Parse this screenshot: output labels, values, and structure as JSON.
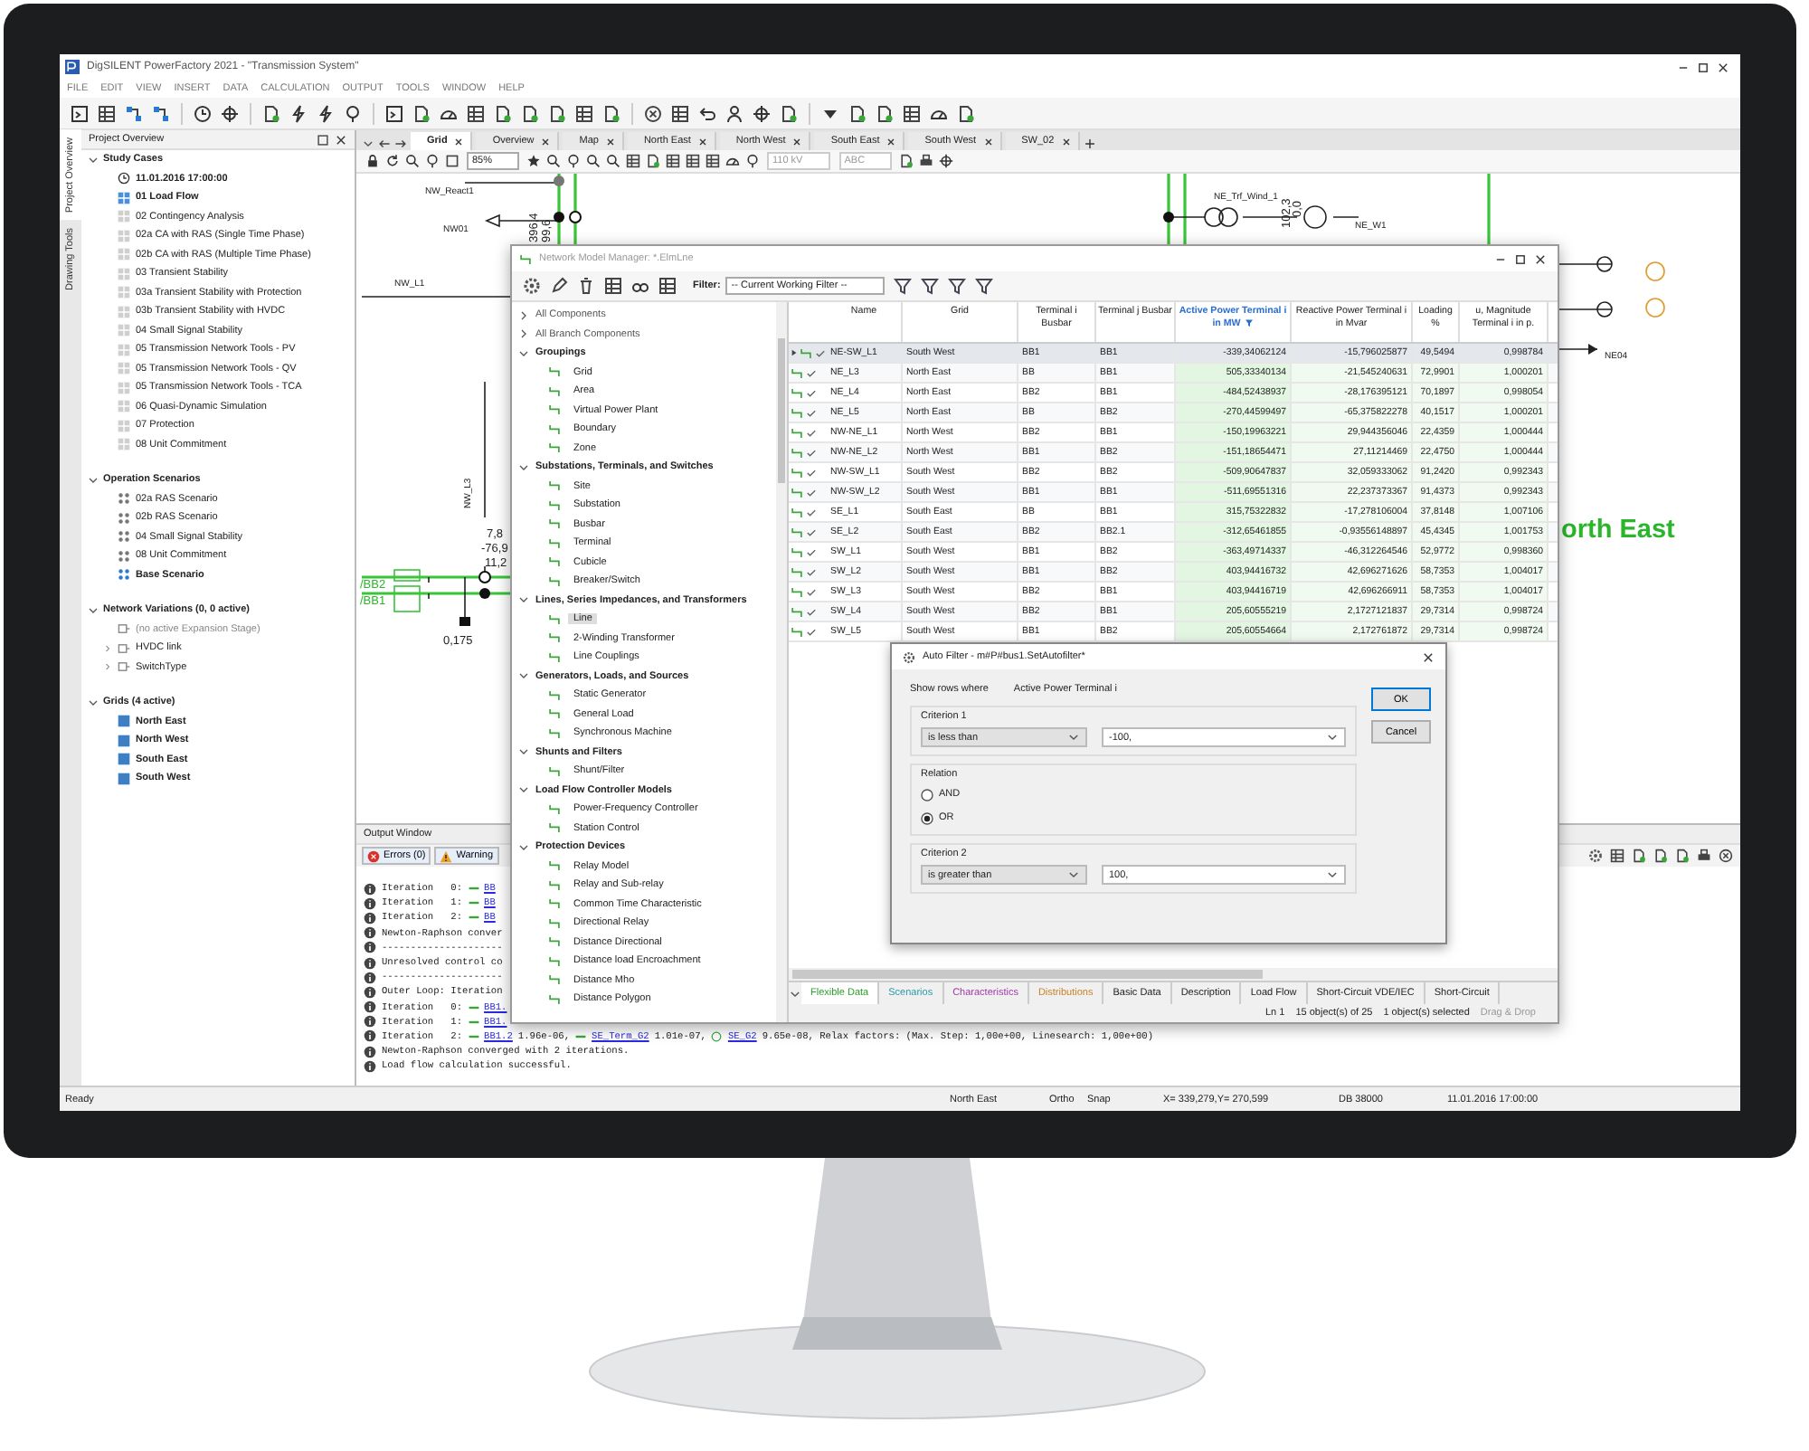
{
  "window": {
    "title": "DigSILENT PowerFactory 2021 - \"Transmission System\""
  },
  "menu": [
    "FILE",
    "EDIT",
    "VIEW",
    "INSERT",
    "DATA",
    "CALCULATION",
    "OUTPUT",
    "TOOLS",
    "WINDOW",
    "HELP"
  ],
  "side_tabs": [
    {
      "label": "Project Overview",
      "selected": true
    },
    {
      "label": "Drawing Tools",
      "selected": false
    }
  ],
  "project_overview": {
    "title": "Project Overview",
    "sections": [
      {
        "title": "Study Cases",
        "expanded": true,
        "items": [
          {
            "label": "11.01.2016 17:00:00",
            "kind": "time",
            "active": true
          },
          {
            "label": "01 Load Flow",
            "kind": "case",
            "active": true
          },
          {
            "label": "02 Contingency Analysis",
            "kind": "case",
            "active": false
          },
          {
            "label": "02a CA with RAS (Single Time Phase)",
            "kind": "case",
            "active": false
          },
          {
            "label": "02b CA with RAS (Multiple Time Phase)",
            "kind": "case",
            "active": false
          },
          {
            "label": "03 Transient Stability",
            "kind": "case",
            "active": false
          },
          {
            "label": "03a Transient Stability with Protection",
            "kind": "case",
            "active": false
          },
          {
            "label": "03b Transient Stability with HVDC",
            "kind": "case",
            "active": false
          },
          {
            "label": "04 Small Signal Stability",
            "kind": "case",
            "active": false
          },
          {
            "label": "05 Transmission Network Tools - PV",
            "kind": "case",
            "active": false
          },
          {
            "label": "05 Transmission Network Tools - QV",
            "kind": "case",
            "active": false
          },
          {
            "label": "05 Transmission Network Tools - TCA",
            "kind": "case",
            "active": false
          },
          {
            "label": "06 Quasi-Dynamic Simulation",
            "kind": "case",
            "active": false
          },
          {
            "label": "07 Protection",
            "kind": "case",
            "active": false
          },
          {
            "label": "08 Unit Commitment",
            "kind": "case",
            "active": false
          }
        ]
      },
      {
        "title": "Operation Scenarios",
        "expanded": true,
        "items": [
          {
            "label": "02a RAS Scenario",
            "kind": "scenario",
            "active": false
          },
          {
            "label": "02b RAS Scenario",
            "kind": "scenario",
            "active": false
          },
          {
            "label": "04 Small Signal Stability",
            "kind": "scenario",
            "active": false
          },
          {
            "label": "08 Unit Commitment",
            "kind": "scenario",
            "active": false
          },
          {
            "label": "Base Scenario",
            "kind": "scenario",
            "active": true
          }
        ]
      },
      {
        "title": "Network Variations (0, 0 active)",
        "expanded": true,
        "items": [
          {
            "label": "(no active Expansion Stage)",
            "kind": "stage",
            "active": false
          },
          {
            "label": "HVDC link",
            "kind": "variation",
            "active": false
          },
          {
            "label": "SwitchType",
            "kind": "variation",
            "active": false
          }
        ]
      },
      {
        "title": "Grids (4 active)",
        "expanded": true,
        "items": [
          {
            "label": "North East",
            "kind": "grid",
            "active": true
          },
          {
            "label": "North West",
            "kind": "grid",
            "active": true
          },
          {
            "label": "South East",
            "kind": "grid",
            "active": true
          },
          {
            "label": "South West",
            "kind": "grid",
            "active": true
          }
        ]
      }
    ]
  },
  "diagram_tabs": [
    {
      "label": "Grid",
      "selected": true
    },
    {
      "label": "Overview",
      "selected": false
    },
    {
      "label": "Map",
      "selected": false
    },
    {
      "label": "North East",
      "selected": false
    },
    {
      "label": "North West",
      "selected": false
    },
    {
      "label": "South East",
      "selected": false
    },
    {
      "label": "South West",
      "selected": false
    },
    {
      "label": "SW_02",
      "selected": false
    }
  ],
  "graphics_toolbar": {
    "zoom": "85%",
    "voltage": "110 kV",
    "phase": "ABC"
  },
  "diagram": {
    "labels": [
      {
        "text": "NW_React1",
        "kind": "name"
      },
      {
        "text": "NW01",
        "kind": "name"
      },
      {
        "text": "396,4",
        "kind": "value"
      },
      {
        "text": "99,6",
        "kind": "value"
      },
      {
        "text": "NW_L1",
        "kind": "name"
      },
      {
        "text": "NW_L3",
        "kind": "name"
      },
      {
        "text": "7,8",
        "kind": "value"
      },
      {
        "text": "-76,9",
        "kind": "value"
      },
      {
        "text": "11,2",
        "kind": "value"
      },
      {
        "text": "/BB2",
        "kind": "busbar"
      },
      {
        "text": "/BB1",
        "kind": "busbar"
      },
      {
        "text": "0,175",
        "kind": "value"
      },
      {
        "text": "NE_Trf_Wind_1",
        "kind": "name"
      },
      {
        "text": "102,3",
        "kind": "value"
      },
      {
        "text": "0,0",
        "kind": "value"
      },
      {
        "text": "NE_W1",
        "kind": "name"
      },
      {
        "text": "orth East",
        "kind": "area"
      },
      {
        "text": "NE04",
        "kind": "name"
      }
    ]
  },
  "output_window": {
    "title": "Output Window",
    "tabs": [
      {
        "label": "Errors (0)",
        "kind": "error"
      },
      {
        "label": "Warning",
        "kind": "warning"
      }
    ],
    "lines": [
      {
        "parts": [
          {
            "text": "Iteration   0:",
            "kind": "text"
          },
          {
            "text": "BB",
            "kind": "busbar"
          }
        ]
      },
      {
        "parts": [
          {
            "text": "Iteration   1:",
            "kind": "text"
          },
          {
            "text": "BB",
            "kind": "busbar"
          }
        ]
      },
      {
        "parts": [
          {
            "text": "Iteration   2:",
            "kind": "text"
          },
          {
            "text": "BB",
            "kind": "busbar"
          }
        ]
      },
      {
        "parts": [
          {
            "text": "Newton-Raphson conver",
            "kind": "text"
          }
        ]
      },
      {
        "parts": [
          {
            "text": "---------------------",
            "kind": "text"
          }
        ]
      },
      {
        "parts": [
          {
            "text": "Unresolved control co",
            "kind": "text"
          }
        ]
      },
      {
        "parts": [
          {
            "text": "---------------------",
            "kind": "text"
          }
        ]
      },
      {
        "parts": [
          {
            "text": "Outer Loop: Iteration",
            "kind": "text"
          }
        ]
      },
      {
        "parts": [
          {
            "text": "Iteration   0:",
            "kind": "text"
          },
          {
            "text": "BB1.",
            "kind": "busbar"
          }
        ]
      },
      {
        "parts": [
          {
            "text": "Iteration   1:",
            "kind": "text"
          },
          {
            "text": "BB1.",
            "kind": "busbar"
          }
        ]
      },
      {
        "parts": [
          {
            "text": "Iteration   2:",
            "kind": "text"
          },
          {
            "text": "BB1.2",
            "kind": "busbar"
          },
          {
            "text": "1.96e-06,",
            "kind": "text"
          },
          {
            "text": "SE_Term_G2",
            "kind": "busbar"
          },
          {
            "text": "1.01e-07,",
            "kind": "text"
          },
          {
            "text": "SE_G2",
            "kind": "generator"
          },
          {
            "text": "9.65e-08, Relax factors: (Max. Step: 1,00e+00, Linesearch: 1,00e+00)",
            "kind": "text"
          }
        ]
      },
      {
        "parts": [
          {
            "text": "Newton-Raphson converged with 2 iterations.",
            "kind": "text"
          }
        ]
      },
      {
        "parts": [
          {
            "text": "Load flow calculation successful.",
            "kind": "text"
          }
        ]
      }
    ]
  },
  "status_bar": [
    "Ready",
    "North East",
    "Ortho",
    "Snap",
    "X=  339,279,Y=  270,599",
    "DB 38000",
    "11.01.2016 17:00:00"
  ],
  "network_model_manager": {
    "title": "Network Model Manager: *.ElmLne",
    "filter_label": "Filter:",
    "filter": "-- Current Working Filter --",
    "tree": [
      {
        "label": "All Components",
        "expanded": false
      },
      {
        "label": "All Branch Components",
        "expanded": false
      },
      {
        "label": "Groupings",
        "expanded": true,
        "children": [
          {
            "label": "Grid",
            "selected": false
          },
          {
            "label": "Area",
            "selected": false
          },
          {
            "label": "Virtual Power Plant",
            "selected": false
          },
          {
            "label": "Boundary",
            "selected": false
          },
          {
            "label": "Zone",
            "selected": false
          }
        ]
      },
      {
        "label": "Substations, Terminals, and Switches",
        "expanded": true,
        "children": [
          {
            "label": "Site",
            "selected": false
          },
          {
            "label": "Substation",
            "selected": false
          },
          {
            "label": "Busbar",
            "selected": false
          },
          {
            "label": "Terminal",
            "selected": false
          },
          {
            "label": "Cubicle",
            "selected": false
          },
          {
            "label": "Breaker/Switch",
            "selected": false
          }
        ]
      },
      {
        "label": "Lines, Series Impedances, and Transformers",
        "expanded": true,
        "children": [
          {
            "label": "Line",
            "selected": true
          },
          {
            "label": "2-Winding Transformer",
            "selected": false
          },
          {
            "label": "Line Couplings",
            "selected": false
          }
        ]
      },
      {
        "label": "Generators, Loads, and Sources",
        "expanded": true,
        "children": [
          {
            "label": "Static Generator",
            "selected": false
          },
          {
            "label": "General Load",
            "selected": false
          },
          {
            "label": "Synchronous Machine",
            "selected": false
          }
        ]
      },
      {
        "label": "Shunts and Filters",
        "expanded": true,
        "children": [
          {
            "label": "Shunt/Filter",
            "selected": false
          }
        ]
      },
      {
        "label": "Load Flow Controller Models",
        "expanded": true,
        "children": [
          {
            "label": "Power-Frequency Controller",
            "selected": false
          },
          {
            "label": "Station Control",
            "selected": false
          }
        ]
      },
      {
        "label": "Protection Devices",
        "expanded": true,
        "children": [
          {
            "label": "Relay Model",
            "selected": false
          },
          {
            "label": "Relay and Sub-relay",
            "selected": false
          },
          {
            "label": "Common Time Characteristic",
            "selected": false
          },
          {
            "label": "Directional Relay",
            "selected": false
          },
          {
            "label": "Distance Directional",
            "selected": false
          },
          {
            "label": "Distance load Encroachment",
            "selected": false
          },
          {
            "label": "Distance Mho",
            "selected": false
          },
          {
            "label": "Distance Polygon",
            "selected": false
          }
        ]
      }
    ],
    "table": {
      "columns": [
        {
          "label": "Name",
          "filtered": false,
          "kind": "text"
        },
        {
          "label": "Grid",
          "filtered": false,
          "kind": "text"
        },
        {
          "label": "Terminal i Busbar",
          "filtered": false,
          "kind": "text"
        },
        {
          "label": "Terminal j Busbar",
          "filtered": false,
          "kind": "text"
        },
        {
          "label": "Active Power Terminal i in MW",
          "filtered": true,
          "kind": "result"
        },
        {
          "label": "Reactive Power Terminal i in Mvar",
          "filtered": false,
          "kind": "result"
        },
        {
          "label": "Loading %",
          "filtered": false,
          "kind": "result"
        },
        {
          "label": "u, Magnitude Terminal i in p.",
          "filtered": false,
          "kind": "result"
        }
      ],
      "rows": [
        {
          "selected": true,
          "cells": [
            "NE-SW_L1",
            "South West",
            "BB1",
            "BB1",
            "-339,34062124",
            "-15,796025877",
            "49,5494",
            "0,998784"
          ]
        },
        {
          "selected": false,
          "cells": [
            "NE_L3",
            "North East",
            "BB",
            "BB1",
            "505,33340134",
            "-21,545240631",
            "72,9901",
            "1,000201"
          ]
        },
        {
          "selected": false,
          "cells": [
            "NE_L4",
            "North East",
            "BB2",
            "BB1",
            "-484,52438937",
            "-28,176395121",
            "70,1897",
            "0,998054"
          ]
        },
        {
          "selected": false,
          "cells": [
            "NE_L5",
            "North East",
            "BB",
            "BB2",
            "-270,44599497",
            "-65,375822278",
            "40,1517",
            "1,000201"
          ]
        },
        {
          "selected": false,
          "cells": [
            "NW-NE_L1",
            "North West",
            "BB2",
            "BB1",
            "-150,19963221",
            "29,944356046",
            "22,4359",
            "1,000444"
          ]
        },
        {
          "selected": false,
          "cells": [
            "NW-NE_L2",
            "North West",
            "BB1",
            "BB2",
            "-151,18654471",
            "27,11214469",
            "22,4750",
            "1,000444"
          ]
        },
        {
          "selected": false,
          "cells": [
            "NW-SW_L1",
            "South West",
            "BB2",
            "BB2",
            "-509,90647837",
            "32,059333062",
            "91,2420",
            "0,992343"
          ]
        },
        {
          "selected": false,
          "cells": [
            "NW-SW_L2",
            "South West",
            "BB1",
            "BB1",
            "-511,69551316",
            "22,237373367",
            "91,4373",
            "0,992343"
          ]
        },
        {
          "selected": false,
          "cells": [
            "SE_L1",
            "South East",
            "BB",
            "BB1",
            "315,75322832",
            "-17,278106004",
            "37,8148",
            "1,007106"
          ]
        },
        {
          "selected": false,
          "cells": [
            "SE_L2",
            "South East",
            "BB2",
            "BB2.1",
            "-312,65461855",
            "-0,93556148897",
            "45,4345",
            "1,001753"
          ]
        },
        {
          "selected": false,
          "cells": [
            "SW_L1",
            "South West",
            "BB1",
            "BB2",
            "-363,49714337",
            "-46,312264546",
            "52,9772",
            "0,998360"
          ]
        },
        {
          "selected": false,
          "cells": [
            "SW_L2",
            "South West",
            "BB1",
            "BB2",
            "403,94416732",
            "42,696271626",
            "58,7353",
            "1,004017"
          ]
        },
        {
          "selected": false,
          "cells": [
            "SW_L3",
            "South West",
            "BB2",
            "BB1",
            "403,94416719",
            "42,696266911",
            "58,7353",
            "1,004017"
          ]
        },
        {
          "selected": false,
          "cells": [
            "SW_L4",
            "South West",
            "BB2",
            "BB1",
            "205,60555219",
            "2,1727121837",
            "29,7314",
            "0,998724"
          ]
        },
        {
          "selected": false,
          "cells": [
            "SW_L5",
            "South West",
            "BB1",
            "BB2",
            "205,60554664",
            "2,172761872",
            "29,7314",
            "0,998724"
          ]
        }
      ]
    },
    "bottom_tabs": [
      {
        "label": "Flexible Data",
        "selected": true,
        "color": "#2e9c2e"
      },
      {
        "label": "Scenarios",
        "selected": false,
        "color": "#2a9aa8"
      },
      {
        "label": "Characteristics",
        "selected": false,
        "color": "#a03aa8"
      },
      {
        "label": "Distributions",
        "selected": false,
        "color": "#c8822a"
      },
      {
        "label": "Basic Data",
        "selected": false,
        "color": "#222222"
      },
      {
        "label": "Description",
        "selected": false,
        "color": "#222222"
      },
      {
        "label": "Load Flow",
        "selected": false,
        "color": "#222222"
      },
      {
        "label": "Short-Circuit VDE/IEC",
        "selected": false,
        "color": "#222222"
      },
      {
        "label": "Short-Circuit",
        "selected": false,
        "color": "#222222"
      }
    ],
    "status": [
      "Ln 1",
      "15 object(s) of 25",
      "1 object(s) selected",
      "Drag & Drop"
    ]
  },
  "auto_filter": {
    "title": "Auto Filter - m#P#bus1.SetAutofilter*",
    "show_rows_label": "Show rows where",
    "column": "Active Power Terminal i",
    "criterion_1": {
      "title": "Criterion 1",
      "operator": "is less than",
      "value": "-100,"
    },
    "relation": {
      "title": "Relation",
      "options": [
        {
          "label": "AND",
          "selected": false
        },
        {
          "label": "OR",
          "selected": true
        }
      ]
    },
    "criterion_2": {
      "title": "Criterion 2",
      "operator": "is greater than",
      "value": "100,"
    },
    "buttons": [
      {
        "label": "OK",
        "default": true
      },
      {
        "label": "Cancel",
        "default": false
      }
    ]
  }
}
